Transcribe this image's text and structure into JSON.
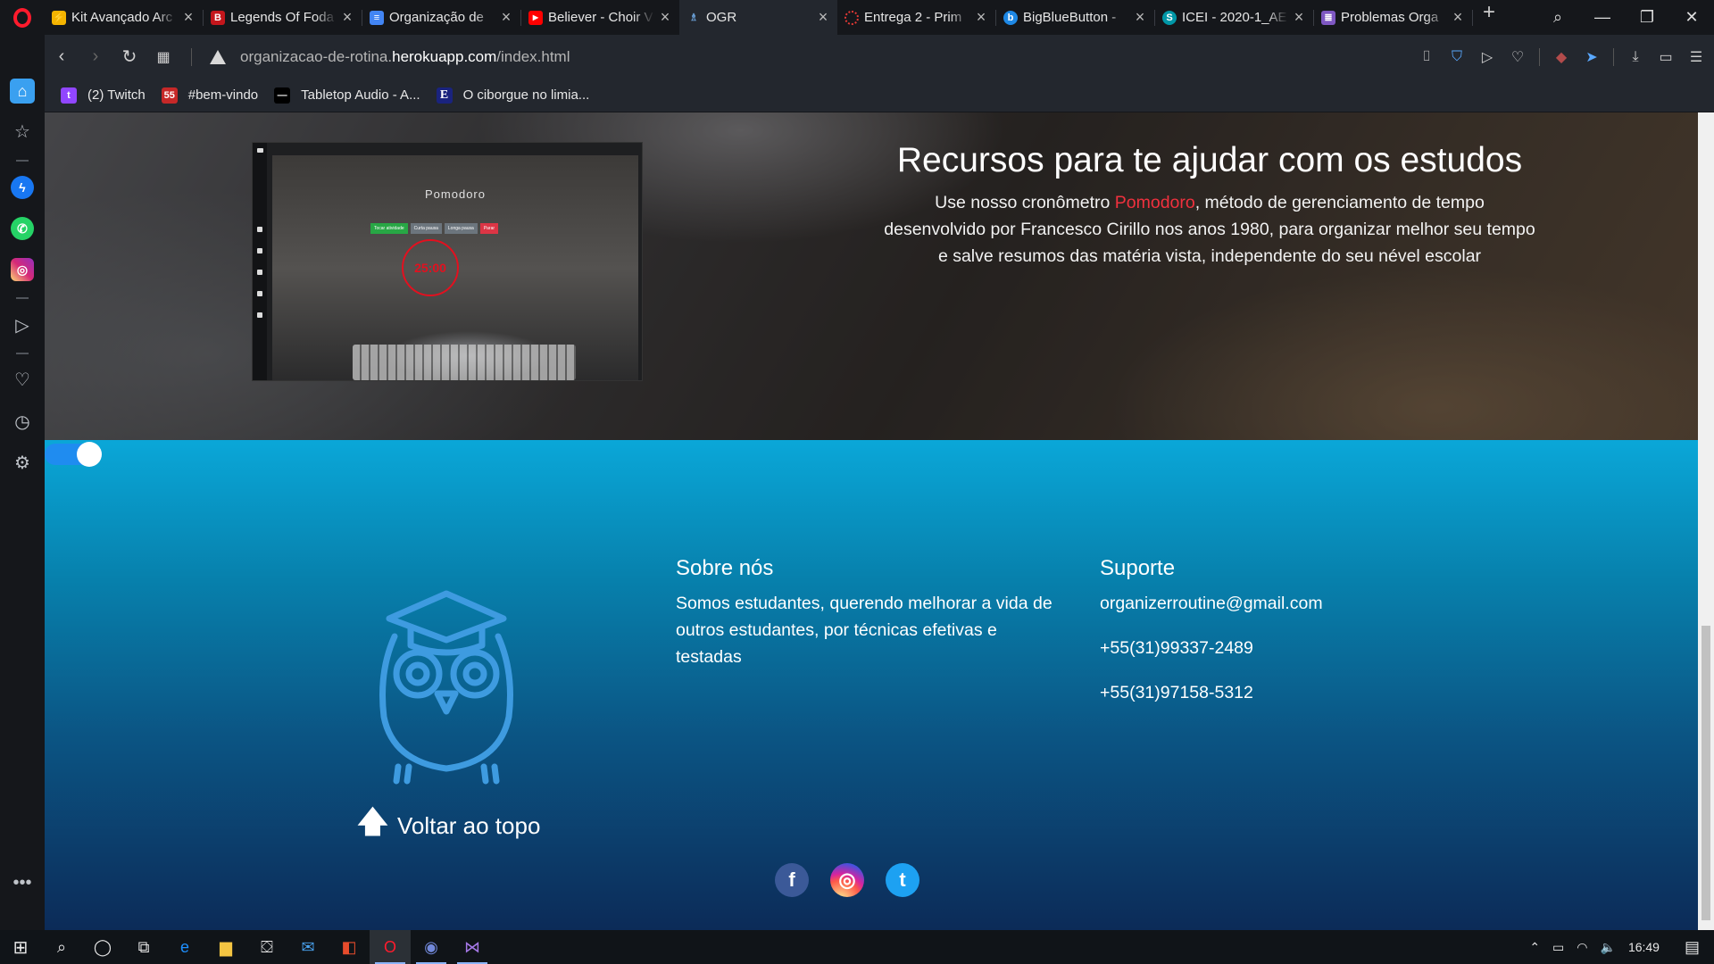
{
  "browser": {
    "tabs": [
      {
        "title": "Kit Avançado Arc",
        "icon_color": "#f4b400",
        "icon_glyph": "⚡"
      },
      {
        "title": "Legends Of Foda",
        "icon_color": "#c4161c",
        "icon_glyph": "B"
      },
      {
        "title": "Organização de",
        "icon_color": "#4285f4",
        "icon_glyph": "≡"
      },
      {
        "title": "Believer - Choir V",
        "icon_color": "#ff0000",
        "icon_glyph": "▶"
      },
      {
        "title": "OGR",
        "icon_color": "#6aa0d8",
        "icon_glyph": "🦉",
        "active": true
      },
      {
        "title": "Entrega 2 - Prim",
        "icon_color": "#e53935",
        "icon_glyph": "◌"
      },
      {
        "title": "BigBlueButton -",
        "icon_color": "#1e88e5",
        "icon_glyph": "b"
      },
      {
        "title": "ICEI - 2020-1_AE",
        "icon_color": "#0097a7",
        "icon_glyph": "S"
      },
      {
        "title": "Problemas Orga",
        "icon_color": "#7e57c2",
        "icon_glyph": "≣"
      }
    ],
    "address": {
      "prefix": "organizacao-de-rotina.",
      "host": "herokuapp.com",
      "path": "/index.html"
    },
    "bookmarks": [
      {
        "label": "(2) Twitch",
        "icon_color": "#9146ff",
        "icon_glyph": "t"
      },
      {
        "label": "#bem-vindo",
        "icon_color": "#c62828",
        "icon_glyph": "55"
      },
      {
        "label": "Tabletop Audio - A...",
        "icon_color": "#000000",
        "icon_glyph": "—"
      },
      {
        "label": "O ciborgue no limia...",
        "icon_color": "#1a237e",
        "icon_glyph": "E"
      }
    ]
  },
  "hero": {
    "title": "Recursos para te ajudar com os estudos",
    "desc_before": "Use nosso cronômetro ",
    "desc_highlight": "Pomodoro",
    "desc_after": ", método de gerenciamento de tempo desenvolvido por Francesco Cirillo nos anos 1980, para organizar melhor seu tempo e salve resumos das matéria vista, independente do seu nével escolar",
    "highlight_color": "#f0313e",
    "screenshot": {
      "title": "Pomodoro",
      "buttons": [
        "Tocar atividade",
        "Curta pausa",
        "Longa pausa",
        "Parar"
      ],
      "button_colors": [
        "#28a745",
        "#6c757d",
        "#6c757d",
        "#dc3545"
      ],
      "timer": "25:00"
    }
  },
  "footer": {
    "back_to_top": "Voltar ao topo",
    "about": {
      "heading": "Sobre nós",
      "text": "Somos estudantes, querendo melhorar a vida de outros estudantes, por técnicas efetivas e testadas"
    },
    "support": {
      "heading": "Suporte",
      "email": "organizerroutine@gmail.com",
      "phone1": "+55(31)99337-2489",
      "phone2": "+55(31)97158-5312"
    },
    "socials": [
      {
        "name": "facebook-icon",
        "glyph": "f",
        "color": "#3b5998"
      },
      {
        "name": "instagram-icon",
        "glyph": "◎",
        "color": "#d6249f"
      },
      {
        "name": "twitter-icon",
        "glyph": "t",
        "color": "#1da1f2"
      }
    ]
  },
  "taskbar": {
    "time": "16:49"
  }
}
